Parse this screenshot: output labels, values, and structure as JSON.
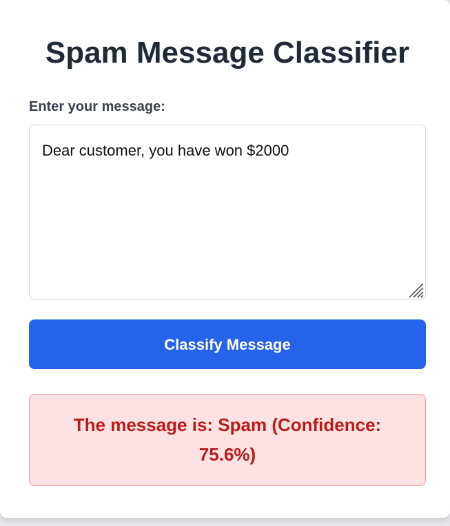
{
  "app": {
    "title": "Spam Message Classifier"
  },
  "form": {
    "message_label": "Enter your message:",
    "message_value": "Dear customer, you have won $2000",
    "classify_label": "Classify Message"
  },
  "result": {
    "text": "The message is: Spam (Confidence: 75.6%)",
    "prediction": "Spam",
    "confidence_percent": 75.6
  },
  "colors": {
    "button": "#2563eb",
    "result_background": "#fee2e2",
    "result_text": "#b91c1c",
    "title": "#1f2937"
  }
}
